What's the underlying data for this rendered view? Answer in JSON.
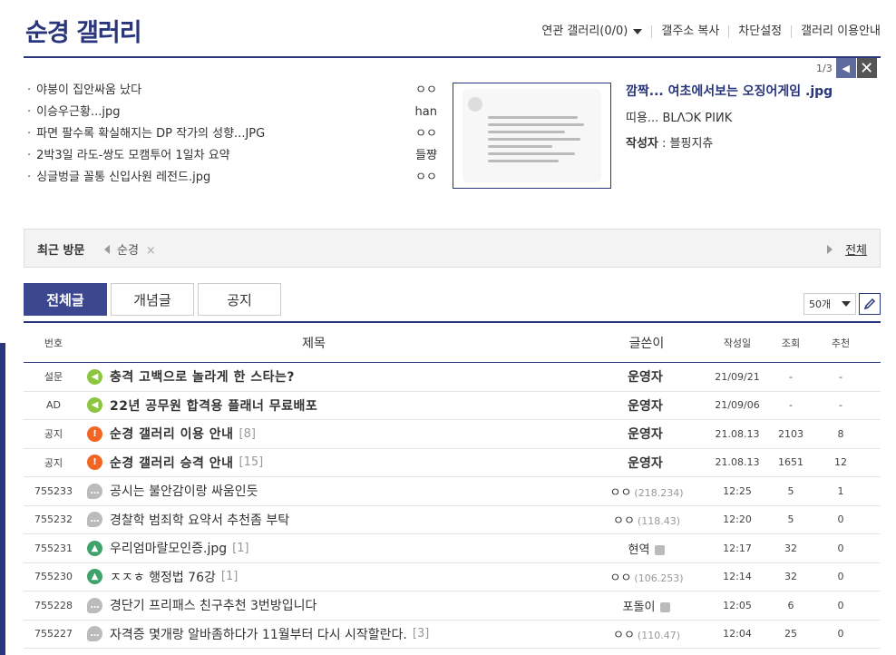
{
  "header": {
    "title": "순경 갤러리",
    "links": [
      "연관 갤러리(0/0)",
      "갤주소 복사",
      "차단설정",
      "갤러리 이용안내"
    ]
  },
  "featured": {
    "items": [
      {
        "title": "야붕이 집안싸움 났다",
        "author": "ㅇㅇ"
      },
      {
        "title": "이승우근황...jpg",
        "author": "han"
      },
      {
        "title": "파면 팔수록 확실해지는 DP 작가의 성향...JPG",
        "author": "ㅇㅇ"
      },
      {
        "title": "2박3일 라도-쌍도 모캠투어 1일차 요약",
        "author": "들쨩"
      },
      {
        "title": "싱글벙글 꼴통 신입사원 레전드.jpg",
        "author": "ㅇㅇ"
      }
    ],
    "pager_count": "1/3",
    "detail_title": "깜짝... 여초에서보는 오징어게임 .jpg",
    "detail_sub": "띠용... BLΛƆK PIИK",
    "author_label": "작성자",
    "author_sep": " : ",
    "author_name": "블핑지츄"
  },
  "recent": {
    "label": "최근 방문",
    "item": "순경",
    "close": "×",
    "all_label": "전체"
  },
  "tabs": [
    "전체글",
    "개념글",
    "공지"
  ],
  "list_count": "50개",
  "columns": {
    "num": "번호",
    "title": "제목",
    "writer": "글쓴이",
    "date": "작성일",
    "views": "조회",
    "rec": "추천"
  },
  "rows": [
    {
      "num": "설문",
      "icon": "speaker-icon",
      "title": "충격 고백으로 놀라게 한 스타는?",
      "comments": "",
      "writer": "운영자",
      "ip": "",
      "date": "21/09/21",
      "views": "-",
      "rec": "-",
      "notice": true
    },
    {
      "num": "AD",
      "icon": "speaker-icon",
      "title": "22년 공무원 합격용 플래너 무료배포",
      "comments": "",
      "writer": "운영자",
      "ip": "",
      "date": "21/09/06",
      "views": "-",
      "rec": "-",
      "notice": true
    },
    {
      "num": "공지",
      "icon": "alert-icon",
      "title": "순경 갤러리 이용 안내",
      "comments": "[8]",
      "writer": "운영자",
      "ip": "",
      "date": "21.08.13",
      "views": "2103",
      "rec": "8",
      "notice": true
    },
    {
      "num": "공지",
      "icon": "alert-icon",
      "title": "순경 갤러리 승격 안내",
      "comments": "[15]",
      "writer": "운영자",
      "ip": "",
      "date": "21.08.13",
      "views": "1651",
      "rec": "12",
      "notice": true
    },
    {
      "num": "755233",
      "icon": "chat-icon",
      "title": "공시는 불안감이랑 싸움인듯",
      "comments": "",
      "writer": "ㅇㅇ",
      "ip": "(218.234)",
      "date": "12:25",
      "views": "5",
      "rec": "1",
      "notice": false
    },
    {
      "num": "755232",
      "icon": "chat-icon",
      "title": "경찰학 범죄학 요약서 추천좀 부탁",
      "comments": "",
      "writer": "ㅇㅇ",
      "ip": "(118.43)",
      "date": "12:20",
      "views": "5",
      "rec": "0",
      "notice": false
    },
    {
      "num": "755231",
      "icon": "image-icon",
      "title": "우리엄마랄모인증.jpg",
      "comments": "[1]",
      "writer": "현역",
      "ip": "",
      "date": "12:17",
      "views": "32",
      "rec": "0",
      "notice": false,
      "fixed": true
    },
    {
      "num": "755230",
      "icon": "image-icon",
      "title": "ㅈㅈㅎ 행정법 76강",
      "comments": "[1]",
      "writer": "ㅇㅇ",
      "ip": "(106.253)",
      "date": "12:14",
      "views": "32",
      "rec": "0",
      "notice": false
    },
    {
      "num": "755228",
      "icon": "chat-icon",
      "title": "경단기 프리패스 친구추천 3번방입니다",
      "comments": "",
      "writer": "포돌이",
      "ip": "",
      "date": "12:05",
      "views": "6",
      "rec": "0",
      "notice": false,
      "fixed": true
    },
    {
      "num": "755227",
      "icon": "chat-icon",
      "title": "자격증 몇개랑 알바좀하다가 11월부터 다시 시작할란다.",
      "comments": "[3]",
      "writer": "ㅇㅇ",
      "ip": "(110.47)",
      "date": "12:04",
      "views": "25",
      "rec": "0",
      "notice": false
    }
  ],
  "colors": {
    "brand": "#29367c",
    "tab_active": "#3b4890",
    "alert": "#f26522",
    "speaker": "#8cc63f",
    "image": "#3fa36b"
  }
}
